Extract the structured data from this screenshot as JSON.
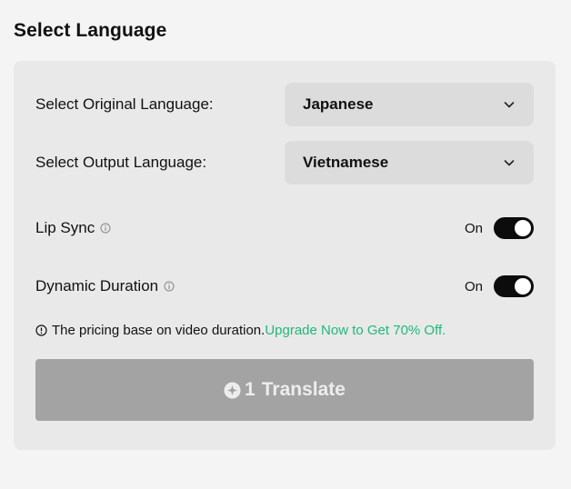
{
  "section": {
    "title": "Select Language"
  },
  "original_language": {
    "label": "Select Original Language:",
    "value": "Japanese"
  },
  "output_language": {
    "label": "Select Output Language:",
    "value": "Vietnamese"
  },
  "lip_sync": {
    "label": "Lip Sync",
    "state": "On"
  },
  "dynamic_duration": {
    "label": "Dynamic Duration",
    "state": "On"
  },
  "pricing_note": {
    "text": "The pricing base on video duration.",
    "link": "Upgrade Now to Get 70% Off."
  },
  "translate_button": {
    "count": "1",
    "label": "Translate"
  },
  "colors": {
    "accent_link": "#1fb97a",
    "toggle_on": "#0c0c0c",
    "button_disabled": "#a3a3a3"
  }
}
